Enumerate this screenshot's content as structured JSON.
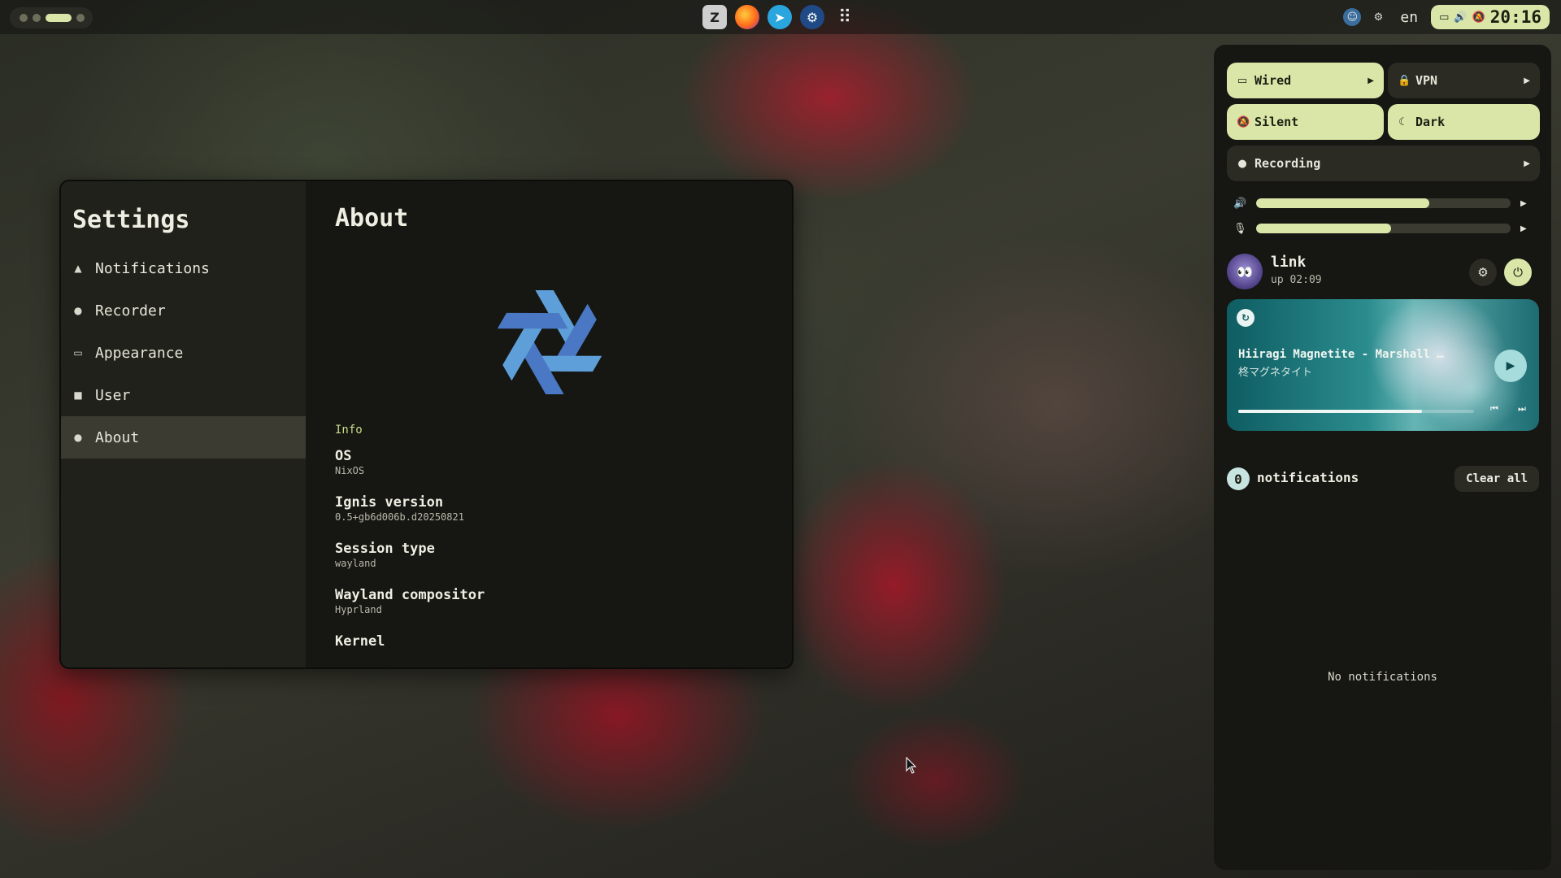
{
  "topbar": {
    "apps": [
      {
        "name": "zed",
        "glyph": "Z"
      },
      {
        "name": "firefox",
        "glyph": "●"
      },
      {
        "name": "telegram",
        "glyph": "➤"
      },
      {
        "name": "steam",
        "glyph": "⚙"
      },
      {
        "name": "app-grid",
        "glyph": "⠿"
      }
    ],
    "language": "en",
    "clock": "20:16"
  },
  "settings": {
    "title": "Settings",
    "nav": [
      {
        "label": "Notifications",
        "icon": "bell-icon",
        "glyph": "🔔"
      },
      {
        "label": "Recorder",
        "icon": "record-icon",
        "glyph": "●"
      },
      {
        "label": "Appearance",
        "icon": "monitor-icon",
        "glyph": "▭"
      },
      {
        "label": "User",
        "icon": "chat-icon",
        "glyph": "■"
      },
      {
        "label": "About",
        "icon": "info-icon",
        "glyph": "ℹ"
      }
    ],
    "active": "About",
    "page_title": "About",
    "info_label": "Info",
    "info": [
      {
        "key": "OS",
        "value": "NixOS"
      },
      {
        "key": "Ignis version",
        "value": "0.5+gb6d006b.d20250821"
      },
      {
        "key": "Session type",
        "value": "wayland"
      },
      {
        "key": "Wayland compositor",
        "value": "Hyprland"
      },
      {
        "key": "Kernel",
        "value": ""
      }
    ]
  },
  "control_center": {
    "tiles": {
      "wired": "Wired",
      "vpn": "VPN",
      "silent": "Silent",
      "dark": "Dark",
      "recording": "Recording"
    },
    "volume_level": 0.68,
    "mic_level": 0.53,
    "user": {
      "name": "link",
      "uptime": "up 02:09"
    },
    "media": {
      "title": "Hiiragi Magnetite - Marshall …",
      "artist": "柊マグネタイト",
      "progress": 0.78
    },
    "notifications": {
      "count": "0",
      "label": "notifications",
      "clear_label": "Clear all",
      "empty_text": "No notifications"
    }
  },
  "colors": {
    "accent": "#d9e6a8",
    "info_label": "#c9dd8a",
    "panel_bg": "#161612",
    "sidebar_bg": "#21211b",
    "active_item": "#3b3b31"
  }
}
